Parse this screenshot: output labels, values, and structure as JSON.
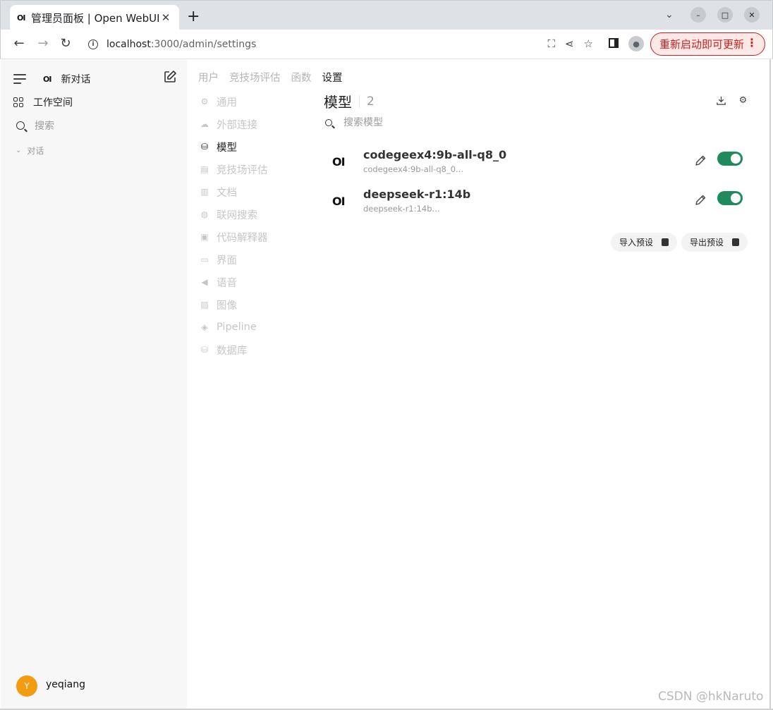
{
  "browser": {
    "tab_title": "管理员面板 | Open WebUI",
    "tab_favicon": "OI",
    "url_host": "localhost",
    "url_path": ":3000/admin/settings",
    "update_label": "重新启动即可更新",
    "update_color": "#c5221f"
  },
  "sidebar": {
    "logo": "OI",
    "new_chat": "新对话",
    "workspace": "工作空间",
    "search": "搜索",
    "chats_header": "对话",
    "user_initial": "Y",
    "username": "yeqiang",
    "avatar_color": "#f39c12"
  },
  "admin_tabs": [
    "用户",
    "竞技场评估",
    "函数",
    "设置"
  ],
  "settings_nav": [
    {
      "label": "通用",
      "icon": "gear-icon"
    },
    {
      "label": "外部连接",
      "icon": "cloud-icon"
    },
    {
      "label": "模型",
      "icon": "database-icon"
    },
    {
      "label": "竞技场评估",
      "icon": "document-icon"
    },
    {
      "label": "文档",
      "icon": "file-icon"
    },
    {
      "label": "联网搜索",
      "icon": "globe-icon"
    },
    {
      "label": "代码解释器",
      "icon": "terminal-icon"
    },
    {
      "label": "界面",
      "icon": "monitor-icon"
    },
    {
      "label": "语音",
      "icon": "speaker-icon"
    },
    {
      "label": "图像",
      "icon": "image-icon"
    },
    {
      "label": "Pipeline",
      "icon": "layers-icon"
    },
    {
      "label": "数据库",
      "icon": "database-icon"
    }
  ],
  "models": {
    "title": "模型",
    "count": "2",
    "search_placeholder": "搜索模型",
    "items": [
      {
        "logo": "OI",
        "name": "codegeex4:9b-all-q8_0",
        "sub": "codegeex4:9b-all-q8_0...",
        "enabled": true
      },
      {
        "logo": "OI",
        "name": "deepseek-r1:14b",
        "sub": "deepseek-r1:14b...",
        "enabled": true
      }
    ],
    "import_label": "导入预设",
    "export_label": "导出预设",
    "toggle_color": "#1f8a5b"
  },
  "watermark": "CSDN @hkNaruto"
}
